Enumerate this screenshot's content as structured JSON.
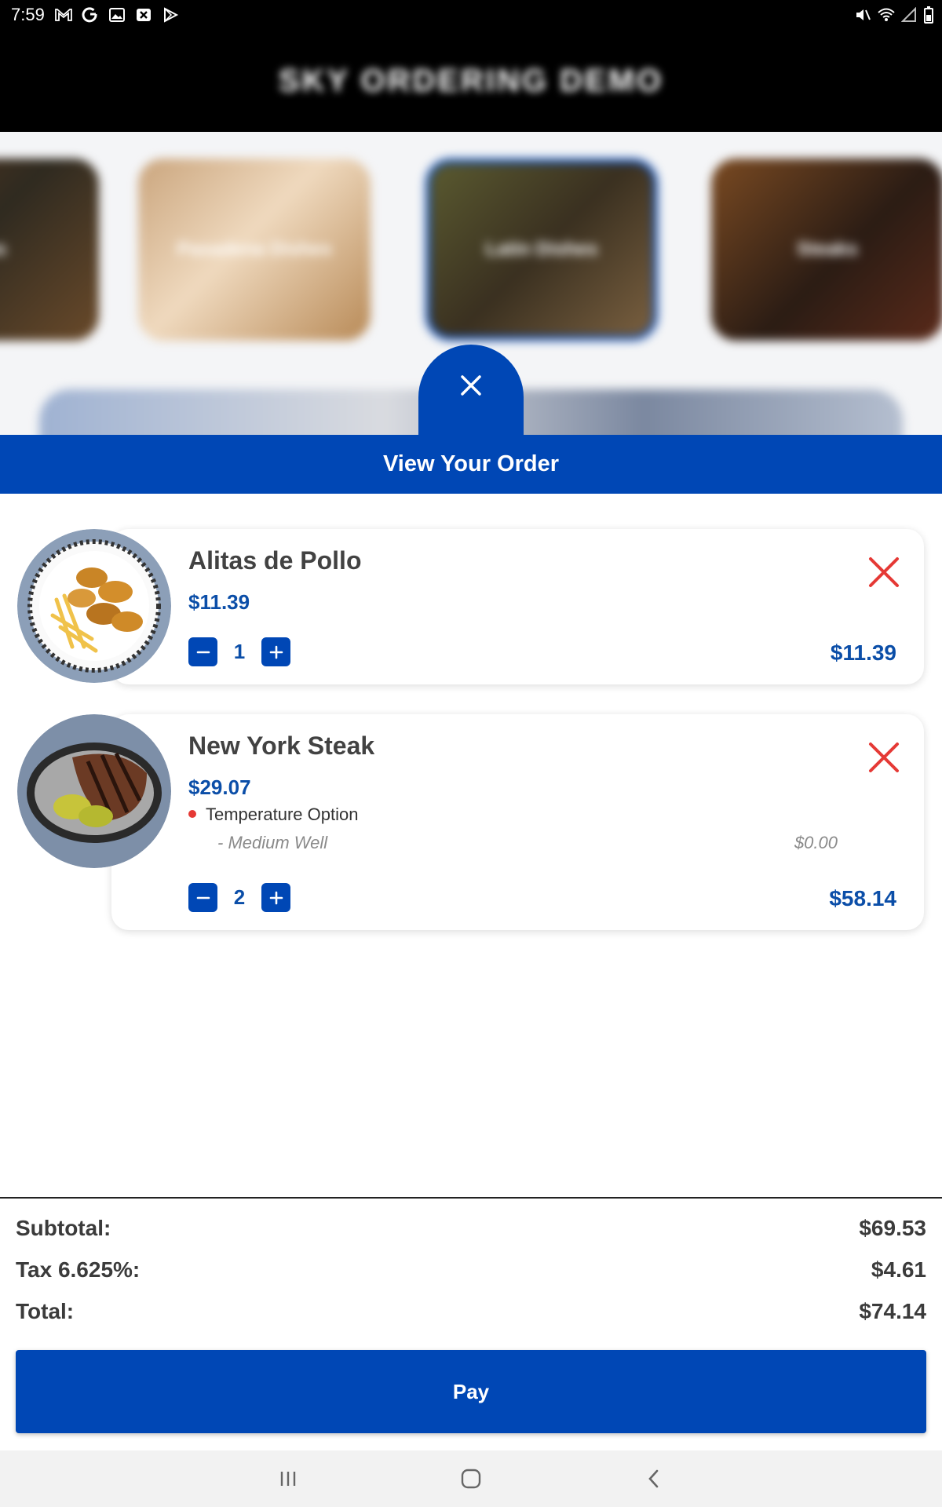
{
  "status_bar": {
    "time": "7:59",
    "left_icons": [
      "gmail-icon",
      "google-icon",
      "gallery-icon",
      "x-app-icon",
      "play-store-icon"
    ],
    "right_icons": [
      "mute-icon",
      "wifi-icon",
      "signal-icon",
      "battery-icon"
    ]
  },
  "app": {
    "title": "SKY ORDERING DEMO",
    "categories": [
      {
        "label": "Apps"
      },
      {
        "label": "Pasadena Dishes"
      },
      {
        "label": "Latin Dishes"
      },
      {
        "label": "Steaks"
      }
    ]
  },
  "order": {
    "header": "View Your Order",
    "items": [
      {
        "name": "Alitas de Pollo",
        "price": "$11.39",
        "quantity": "1",
        "line_total": "$11.39"
      },
      {
        "name": "New York Steak",
        "price": "$29.07",
        "option_label": "Temperature Option",
        "option_value": "- Medium Well",
        "option_price": "$0.00",
        "quantity": "2",
        "line_total": "$58.14"
      }
    ]
  },
  "summary": {
    "subtotal_label": "Subtotal:",
    "subtotal_value": "$69.53",
    "tax_label": "Tax 6.625%:",
    "tax_value": "$4.61",
    "total_label": "Total:",
    "total_value": "$74.14"
  },
  "pay_button": "Pay",
  "colors": {
    "primary": "#0047b5",
    "price_text": "#0b4ea8",
    "remove_red": "#e53935",
    "status_bar": "#000000"
  },
  "nav": [
    "recent-apps-icon",
    "home-icon",
    "back-icon"
  ]
}
